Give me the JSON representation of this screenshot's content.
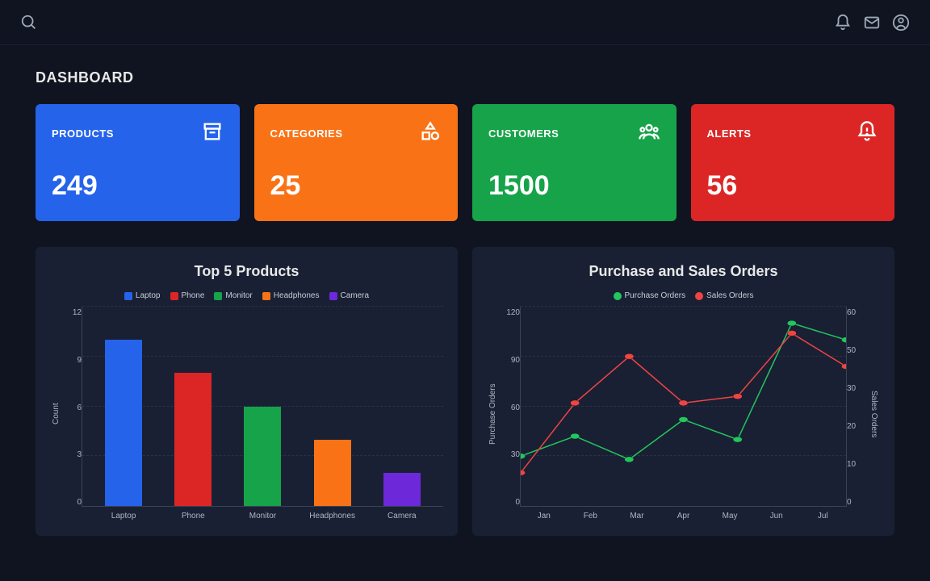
{
  "page": {
    "title": "DASHBOARD"
  },
  "cards": [
    {
      "label": "PRODUCTS",
      "value": "249",
      "color": "c-blue",
      "icon": "archive"
    },
    {
      "label": "CATEGORIES",
      "value": "25",
      "color": "c-orange",
      "icon": "shapes"
    },
    {
      "label": "CUSTOMERS",
      "value": "1500",
      "color": "c-green",
      "icon": "people"
    },
    {
      "label": "ALERTS",
      "value": "56",
      "color": "c-red",
      "icon": "alert"
    }
  ],
  "chart_data": [
    {
      "id": "top5",
      "type": "bar",
      "title": "Top 5 Products",
      "ylabel": "Count",
      "xlabel": "",
      "ylim": [
        0,
        12
      ],
      "yticks": [
        0,
        3,
        6,
        9,
        12
      ],
      "categories": [
        "Laptop",
        "Phone",
        "Monitor",
        "Headphones",
        "Camera"
      ],
      "series": [
        {
          "name": "Laptop",
          "color": "#2563eb",
          "values": [
            10
          ]
        },
        {
          "name": "Phone",
          "color": "#dc2626",
          "values": [
            8
          ]
        },
        {
          "name": "Monitor",
          "color": "#16a34a",
          "values": [
            6
          ]
        },
        {
          "name": "Headphones",
          "color": "#f97316",
          "values": [
            4
          ]
        },
        {
          "name": "Camera",
          "color": "#6d28d9",
          "values": [
            2
          ]
        }
      ]
    },
    {
      "id": "orders",
      "type": "line",
      "title": "Purchase and Sales Orders",
      "xlabel": "",
      "ylabel_left": "Purchase Orders",
      "ylabel_right": "Sales Orders",
      "ylim_left": [
        0,
        120
      ],
      "yticks_left": [
        0,
        30,
        60,
        90,
        120
      ],
      "ylim_right": [
        0,
        60
      ],
      "yticks_right": [
        0,
        10,
        20,
        30,
        50,
        60
      ],
      "x": [
        "Jan",
        "Feb",
        "Mar",
        "Apr",
        "May",
        "Jun",
        "Jul"
      ],
      "series": [
        {
          "name": "Purchase Orders",
          "color": "#22c55e",
          "axis": "left",
          "values": [
            30,
            42,
            28,
            52,
            40,
            110,
            100
          ]
        },
        {
          "name": "Sales Orders",
          "color": "#ef4444",
          "axis": "right",
          "values": [
            10,
            31,
            45,
            31,
            33,
            52,
            42
          ]
        }
      ]
    }
  ]
}
